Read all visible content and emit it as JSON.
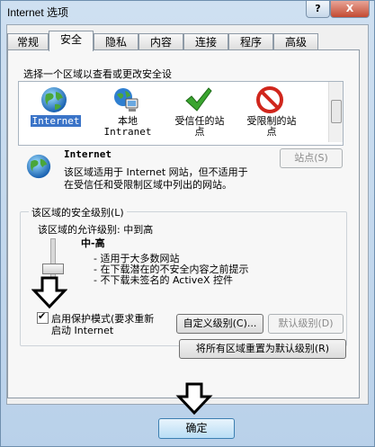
{
  "window": {
    "title": "Internet 选项",
    "help_glyph": "?",
    "close_glyph": "X"
  },
  "tabs": [
    {
      "label": "常规"
    },
    {
      "label": "安全"
    },
    {
      "label": "隐私"
    },
    {
      "label": "内容"
    },
    {
      "label": "连接"
    },
    {
      "label": "程序"
    },
    {
      "label": "高级"
    }
  ],
  "security": {
    "zone_prompt": "选择一个区域以查看或更改安全设",
    "zones": [
      {
        "line1": "Internet",
        "line2": "",
        "icon": "globe-icon"
      },
      {
        "line1": "本地",
        "line2": "Intranet",
        "icon": "intranet-icon"
      },
      {
        "line1": "受信任的站",
        "line2": "点",
        "icon": "check-icon"
      },
      {
        "line1": "受限制的站",
        "line2": "点",
        "icon": "restricted-icon"
      }
    ],
    "selected_zone": {
      "name": "Internet",
      "desc_line1": "该区域适用于 Internet 网站，但不适用于",
      "desc_line2": "在受信任和受限制区域中列出的网站。"
    },
    "sites_button": "站点(S)",
    "level_group_label": "该区域的安全级别(L)",
    "allowed_levels": "该区域的允许级别: 中到高",
    "level_name": "中-高",
    "level_bullets": [
      "- 适用于大多数网站",
      "- 在下载潜在的不安全内容之前提示",
      "- 不下载未签名的 ActiveX 控件"
    ],
    "protected_mode": {
      "line1": "启用保护模式(要求重新",
      "line2": "启动 Internet",
      "checked": true
    },
    "custom_level_button": "自定义级别(C)...",
    "default_level_button": "默认级别(D)",
    "reset_all_button": "将所有区域重置为默认级别(R)"
  },
  "footer": {
    "ok_button": "确定"
  },
  "colors": {
    "accent": "#3b74c8",
    "close_red": "#c34a32",
    "restricted_red": "#d0261c",
    "check_green": "#3aa52f"
  }
}
